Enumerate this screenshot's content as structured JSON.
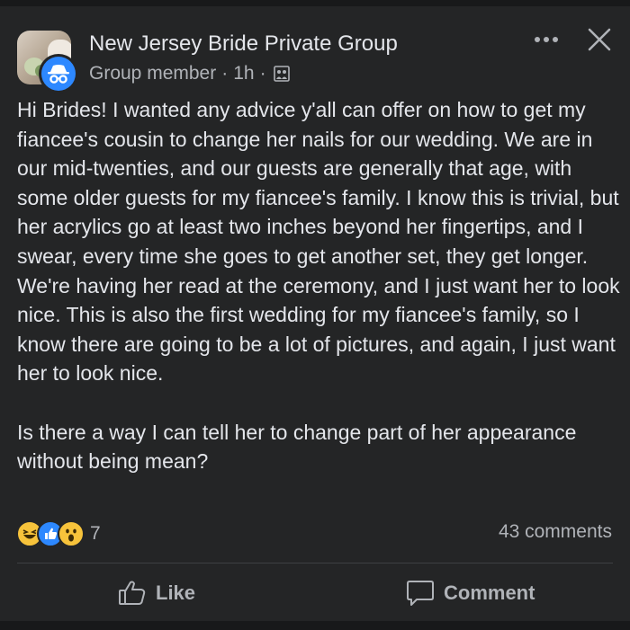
{
  "post": {
    "group_name": "New Jersey Bride Private Group",
    "author_role": "Group member",
    "separator": "·",
    "time_ago": "1h",
    "privacy_icon": "private-group-icon",
    "paragraphs": [
      "Hi Brides! I wanted any advice y'all can offer on how to get my fiancee's cousin to change her nails for our wedding. We are in our mid-twenties, and our guests are generally that age, with some older guests for my fiancee's family. I know this is trivial, but her acrylics go at least two inches beyond her fingertips, and I swear, every time she goes to get another set, they get longer. We're having her read at the ceremony, and I just want her to look nice. This is also the first wedding for my fiancee's family, so I know there are going to be a lot of pictures, and again, I just want her to look nice.",
      "Is there a way I can tell her to change part of her appearance without being mean?"
    ]
  },
  "reactions": {
    "icons": [
      "haha-icon",
      "like-icon",
      "wow-icon"
    ],
    "count": "7"
  },
  "comments_label": "43 comments",
  "actions": {
    "like_label": "Like",
    "comment_label": "Comment"
  },
  "colors": {
    "background": "#242526",
    "text": "#e4e6eb",
    "secondary_text": "#b0b3b8",
    "like_blue": "#2d88ff",
    "reaction_yellow": "#f7c33b"
  }
}
